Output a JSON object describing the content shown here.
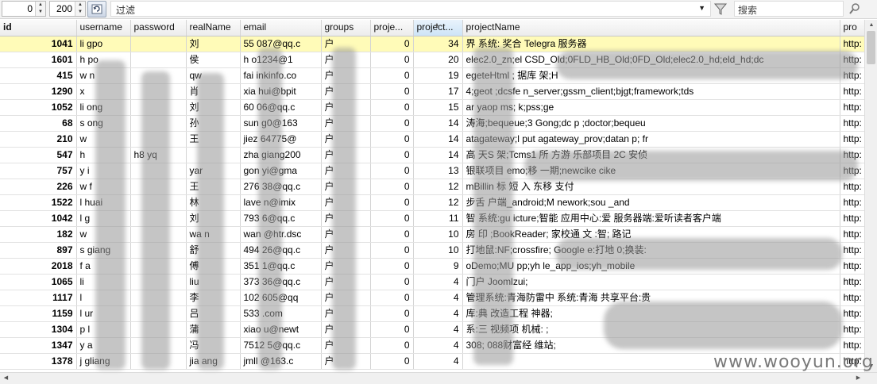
{
  "toolbar": {
    "offset_value": "0",
    "limit_value": "200",
    "filter_label": "过滤",
    "search_placeholder": "搜索"
  },
  "columns": [
    "id",
    "username",
    "password",
    "realName",
    "email",
    "groups",
    "proje...",
    "project...",
    "projectName",
    "pro"
  ],
  "rows": [
    {
      "id": "1041",
      "username": "li   gpo",
      "password": "",
      "realName": "刘",
      "email": "55     087@qq.c",
      "groups": "   户",
      "p1": "0",
      "p2": "34",
      "projectName": "   界         系统:         奖合        Telegra          服务器",
      "pro": "http:"
    },
    {
      "id": "1601",
      "username": "h   po",
      "password": "",
      "realName": "侯",
      "email": "h     o1234@1",
      "groups": "   户",
      "p1": "0",
      "p2": "20",
      "projectName": "   elec2.0_zn;el      CSD_Old;0FLD_HB_Old;0FD_Old;elec2.0_hd;eld_hd;dc",
      "pro": "http:"
    },
    {
      "id": "415",
      "username": "w    n",
      "password": "",
      "realName": "qw",
      "email": "fai     inkinfo.co",
      "groups": "   户",
      "p1": "0",
      "p2": "19",
      "projectName": "   egeteHtml           ;          据库          架;H",
      "pro": "http:"
    },
    {
      "id": "1290",
      "username": "x",
      "password": "",
      "realName": "肖",
      "email": "xia     hui@bpit",
      "groups": "   户",
      "p1": "0",
      "p2": "17",
      "projectName": "   4;geot            ;dcsfe   n_server;gssm_client;bjgt;framework;tds",
      "pro": "http:"
    },
    {
      "id": "1052",
      "username": "li   ong",
      "password": "",
      "realName": "刘",
      "email": "60     06@qq.c",
      "groups": "   户",
      "p1": "0",
      "p2": "15",
      "projectName": "   ar         yaop   ms;                k;pss;ge",
      "pro": "http:"
    },
    {
      "id": "68",
      "username": "s   ong",
      "password": "",
      "realName": "孙",
      "email": "sun     g0@163",
      "groups": "   户",
      "p1": "0",
      "p2": "14",
      "projectName": "          涛海;bequeue;3      Gong;dc   p   ;doctor;bequeu",
      "pro": "http:"
    },
    {
      "id": "210",
      "username": "w",
      "password": "",
      "realName": "王",
      "email": "jiez     64775@",
      "groups": "   户",
      "p1": "0",
      "p2": "14",
      "projectName": "         atagateway;l      put     agateway_prov;datan    p;   fr",
      "pro": "http:"
    },
    {
      "id": "547",
      "username": "h",
      "password": "h8    yq",
      "realName": "",
      "email": "zha     giang200",
      "groups": "   户",
      "p1": "0",
      "p2": "14",
      "projectName": "高   天S    架;Tcms1     所       方游     乐部项目    2C    安侦",
      "pro": "http:"
    },
    {
      "id": "757",
      "username": "y   i",
      "password": "",
      "realName": "yar",
      "email": "gon     yi@gma",
      "groups": "   户",
      "p1": "0",
      "p2": "13",
      "projectName": "银联项目     emo;移       一期;newcike         cike",
      "pro": "http:"
    },
    {
      "id": "226",
      "username": "w   f",
      "password": "",
      "realName": "王",
      "email": "276     38@qq.c",
      "groups": "   户",
      "p1": "0",
      "p2": "12",
      "projectName": "mBillin           标         短           入   东移     支付",
      "pro": "http:"
    },
    {
      "id": "1522",
      "username": "l   huai",
      "password": "",
      "realName": "林",
      "email": "lave     n@imix",
      "groups": "   户",
      "p1": "0",
      "p2": "12",
      "projectName": "步舌             户端_android;M      nework;sou     _and",
      "pro": "http:"
    },
    {
      "id": "1042",
      "username": "l   g",
      "password": "",
      "realName": "刘",
      "email": "793     6@qq.c",
      "groups": "   户",
      "p1": "0",
      "p2": "11",
      "projectName": "智      系统:gu   icture;智能     应用中心:爱      服务器端:爱听读者客户端",
      "pro": "http:"
    },
    {
      "id": "182",
      "username": "w",
      "password": "",
      "realName": "wa    n",
      "email": "wan     @htr.dsc",
      "groups": "   户",
      "p1": "0",
      "p2": "10",
      "projectName": "房     印    ;BookReader;    家校通      文       :智;      路记",
      "pro": "http:"
    },
    {
      "id": "897",
      "username": "s   giang",
      "password": "",
      "realName": "舒",
      "email": "494     26@qq.c",
      "groups": "   户",
      "p1": "0",
      "p2": "10",
      "projectName": "   打地鼠:NF;crossfire;    Google      e:打地     0;换装:",
      "pro": "http:"
    },
    {
      "id": "2018",
      "username": "f   a",
      "password": "",
      "realName": "傅",
      "email": "351     1@qq.c",
      "groups": "   户",
      "p1": "0",
      "p2": "9",
      "projectName": "    oDemo;MU          pp;yh     le_app_ios;yh_mobile",
      "pro": "http:"
    },
    {
      "id": "1065",
      "username": "li",
      "password": "",
      "realName": "liu",
      "email": "373     36@qq.c",
      "groups": "   户",
      "p1": "0",
      "p2": "4",
      "projectName": "门户        Joomlzui;",
      "pro": "http:"
    },
    {
      "id": "1117",
      "username": "l",
      "password": "",
      "realName": "李",
      "email": "102     605@qq",
      "groups": "   户",
      "p1": "0",
      "p2": "4",
      "projectName": "    管理系统:青海防雷中    系统:青海         共享平台:贵",
      "pro": "http:"
    },
    {
      "id": "1159",
      "username": "l   ur",
      "password": "",
      "realName": "吕",
      "email": "533     .com",
      "groups": "   户",
      "p1": "0",
      "p2": "4",
      "projectName": "    库:典    改造工程      神器;",
      "pro": "http:"
    },
    {
      "id": "1304",
      "username": "p   l",
      "password": "",
      "realName": "蒲",
      "email": "xiao     u@newt",
      "groups": "   户",
      "p1": "0",
      "p2": "4",
      "projectName": "    系:三     视频项     机械:      ;",
      "pro": "http:"
    },
    {
      "id": "1347",
      "username": "y   a",
      "password": "",
      "realName": "冯",
      "email": "7512     5@qq.c",
      "groups": "   户",
      "p1": "0",
      "p2": "4",
      "projectName": "    308;     088财富经   维站;",
      "pro": "http:"
    },
    {
      "id": "1378",
      "username": "j   gliang",
      "password": "",
      "realName": "jia    ang",
      "email": "jmll     @163.c",
      "groups": "   户",
      "p1": "0",
      "p2": "4",
      "projectName": "    ",
      "pro": "http:"
    }
  ],
  "watermark": "www.wooyun.org"
}
